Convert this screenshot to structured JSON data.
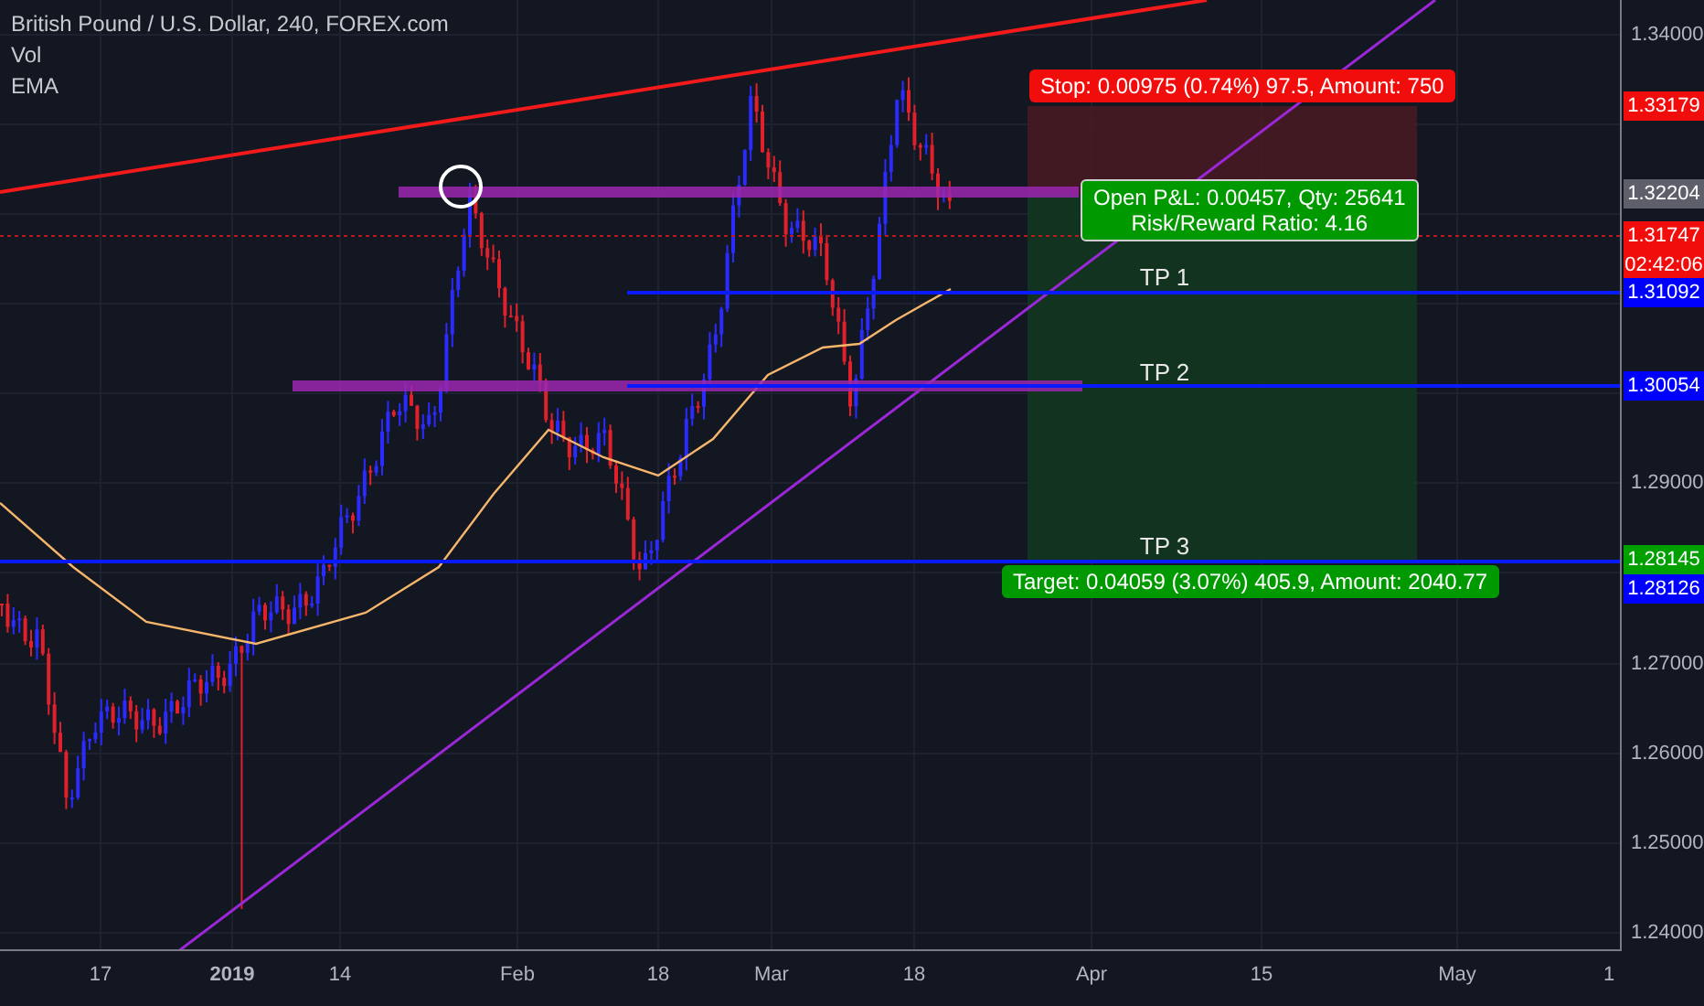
{
  "legend": [
    "British Pound / U.S. Dollar, 240, FOREX.com",
    "Vol",
    "EMA"
  ],
  "position": {
    "stop_label": "Stop: 0.00975 (0.74%) 97.5, Amount: 750",
    "pnl_label": [
      "Open P&L: 0.00457, Qty: 25641",
      "Risk/Reward Ratio: 4.16"
    ],
    "target_label": "Target: 0.04059 (3.07%) 405.9, Amount: 2040.77"
  },
  "targets": [
    "TP 1",
    "TP 2",
    "TP 3"
  ],
  "price_axis": {
    "ticks": [
      "1.34000",
      "1.29000",
      "1.27000",
      "1.26000",
      "1.25000",
      "1.24000"
    ],
    "tags": [
      {
        "text": "1.33179",
        "color": "#f20d0d"
      },
      {
        "text": "1.32204",
        "color": "#5d606b"
      },
      {
        "text": "1.31747",
        "color": "#f20d0d"
      },
      {
        "text": "02:42:06",
        "color": "#f20d0d"
      },
      {
        "text": "1.31092",
        "color": "#0000ff"
      },
      {
        "text": "1.30054",
        "color": "#0000ff"
      },
      {
        "text": "1.28145",
        "color": "#00a000"
      },
      {
        "text": "1.28126",
        "color": "#0000ff"
      }
    ]
  },
  "time_axis": [
    {
      "label": "17",
      "bold": false
    },
    {
      "label": "2019",
      "bold": true
    },
    {
      "label": "14",
      "bold": false
    },
    {
      "label": "Feb",
      "bold": false
    },
    {
      "label": "18",
      "bold": false
    },
    {
      "label": "Mar",
      "bold": false
    },
    {
      "label": "18",
      "bold": false
    },
    {
      "label": "Apr",
      "bold": false
    },
    {
      "label": "15",
      "bold": false
    },
    {
      "label": "May",
      "bold": false
    },
    {
      "label": "1",
      "bold": false
    }
  ]
}
